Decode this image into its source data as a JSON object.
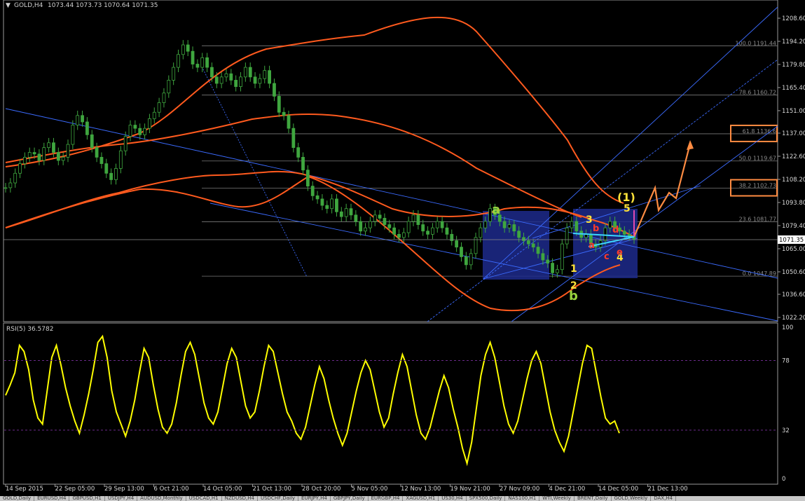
{
  "header": {
    "symbol": "GOLD,H4",
    "ohlc": "1073.44 1073.73 1070.64 1071.35"
  },
  "rsi": {
    "label": "RSI(5) 36.5782"
  },
  "current_price_label": "1071.35",
  "colors": {
    "candles": "#3fa63f",
    "bands": "#ff5a1e",
    "channel": "#3b6bff",
    "rsi": "#ffff00",
    "fib": "#7a7a7a",
    "boxes": "#1d2a8c",
    "projection": "#ff8c42",
    "wave_yellow": "#ffe23a",
    "wave_red": "#ff3a2a"
  },
  "chart_data": [
    {
      "type": "line",
      "title": "GOLD,H4",
      "y_ticks": [
        "1208.60",
        "1194.20",
        "1179.80",
        "1165.40",
        "1151.00",
        "1137.00",
        "1122.60",
        "1108.20",
        "1093.80",
        "1079.40",
        "1065.00",
        "1050.60",
        "1036.60",
        "1022.20"
      ],
      "x_ticks": [
        "14 Sep 2015",
        "22 Sep 05:00",
        "29 Sep 13:00",
        "6 Oct 21:00",
        "14 Oct 05:00",
        "21 Oct 13:00",
        "28 Oct 20:00",
        "5 Nov 05:00",
        "12 Nov 13:00",
        "19 Nov 21:00",
        "27 Nov 09:00",
        "4 Dec 21:00",
        "14 Dec 05:00",
        "21 Dec 13:00"
      ],
      "ylim": [
        1019,
        1213
      ],
      "grid": false,
      "price_path": [
        1103,
        1106,
        1112,
        1118,
        1122,
        1125,
        1124,
        1120,
        1128,
        1131,
        1125,
        1120,
        1122,
        1130,
        1142,
        1148,
        1144,
        1136,
        1128,
        1122,
        1118,
        1112,
        1108,
        1115,
        1126,
        1135,
        1142,
        1140,
        1136,
        1140,
        1146,
        1150,
        1156,
        1162,
        1170,
        1178,
        1186,
        1192,
        1188,
        1180,
        1178,
        1184,
        1178,
        1172,
        1168,
        1172,
        1174,
        1170,
        1166,
        1172,
        1178,
        1172,
        1168,
        1171,
        1176,
        1168,
        1160,
        1150,
        1148,
        1140,
        1128,
        1122,
        1114,
        1104,
        1098,
        1096,
        1092,
        1090,
        1096,
        1088,
        1085,
        1090,
        1086,
        1082,
        1076,
        1078,
        1082,
        1086,
        1084,
        1080,
        1078,
        1074,
        1072,
        1075,
        1082,
        1086,
        1080,
        1076,
        1074,
        1078,
        1082,
        1078,
        1074,
        1070,
        1066,
        1060,
        1055,
        1062,
        1072,
        1078,
        1082,
        1090,
        1086,
        1082,
        1078,
        1080,
        1076,
        1072,
        1070,
        1068,
        1066,
        1062,
        1058,
        1056,
        1050,
        1052,
        1068,
        1078,
        1082,
        1076,
        1072,
        1074,
        1068,
        1066,
        1070,
        1078,
        1082,
        1078,
        1076,
        1074,
        1073,
        1071
      ],
      "fib_levels": [
        {
          "label": "100.0 1191.44",
          "price": 1191.44
        },
        {
          "label": "78.6 1160.72",
          "price": 1160.72
        },
        {
          "label": "61.8 1136.6",
          "price": 1136.6,
          "boxed": true
        },
        {
          "label": "50.0 1119.67",
          "price": 1119.67
        },
        {
          "label": "38.2 1102.73",
          "price": 1102.73,
          "boxed": true
        },
        {
          "label": "23.6 1081.77",
          "price": 1081.77
        },
        {
          "label": "0.0 1047.89",
          "price": 1047.89
        }
      ],
      "wave_labels": [
        {
          "text": "a",
          "color": "green"
        },
        {
          "text": "b",
          "color": "green"
        },
        {
          "text": "1",
          "color": "yellow"
        },
        {
          "text": "2",
          "color": "yellow"
        },
        {
          "text": "3",
          "color": "yellow"
        },
        {
          "text": "4",
          "color": "yellow"
        },
        {
          "text": "5",
          "color": "yellow"
        },
        {
          "text": "(1)",
          "color": "yellow"
        },
        {
          "text": "a",
          "color": "red"
        },
        {
          "text": "b",
          "color": "red"
        },
        {
          "text": "c",
          "color": "red"
        },
        {
          "text": "d",
          "color": "red"
        },
        {
          "text": "e",
          "color": "red"
        }
      ]
    },
    {
      "type": "line",
      "title": "RSI(5) 36.5782",
      "y_ticks": [
        "100",
        "78",
        "32",
        "0"
      ],
      "ylim": [
        0,
        100
      ],
      "levels": [
        78,
        32
      ],
      "values": [
        55,
        62,
        70,
        88,
        84,
        72,
        52,
        40,
        36,
        58,
        80,
        88,
        75,
        60,
        48,
        38,
        30,
        42,
        56,
        72,
        90,
        94,
        80,
        58,
        44,
        36,
        28,
        38,
        52,
        70,
        86,
        80,
        62,
        46,
        34,
        30,
        36,
        50,
        68,
        84,
        90,
        82,
        66,
        50,
        40,
        36,
        44,
        60,
        76,
        86,
        80,
        64,
        48,
        40,
        44,
        58,
        74,
        88,
        84,
        70,
        56,
        44,
        38,
        30,
        26,
        34,
        48,
        62,
        74,
        66,
        52,
        40,
        30,
        22,
        30,
        44,
        58,
        70,
        78,
        72,
        58,
        44,
        34,
        40,
        56,
        70,
        82,
        74,
        58,
        42,
        30,
        26,
        34,
        46,
        58,
        68,
        60,
        46,
        34,
        20,
        10,
        24,
        46,
        68,
        82,
        90,
        80,
        64,
        48,
        36,
        30,
        38,
        52,
        66,
        78,
        84,
        76,
        60,
        44,
        32,
        24,
        18,
        28,
        44,
        60,
        76,
        88,
        86,
        70,
        54,
        40,
        36,
        38,
        30
      ]
    }
  ],
  "tabs": [
    "GOLD,Daily",
    "EURUSD,H4",
    "GBPUSD,H1",
    "USDJPY,H4",
    "AUDUSD,Monthly",
    "USDCAD,H1",
    "NZDUSD,H4",
    "USDCHF,Daily",
    "EURJPY,H4",
    "GBPJPY,Daily",
    "EURGBP,H4",
    "XAGUSD,H1",
    "US30,H4",
    "SPX500,Daily",
    "NAS100,H1",
    "WTI,Weekly",
    "BRENT,Daily",
    "GOLD,Weekly",
    "DAX,H4"
  ]
}
